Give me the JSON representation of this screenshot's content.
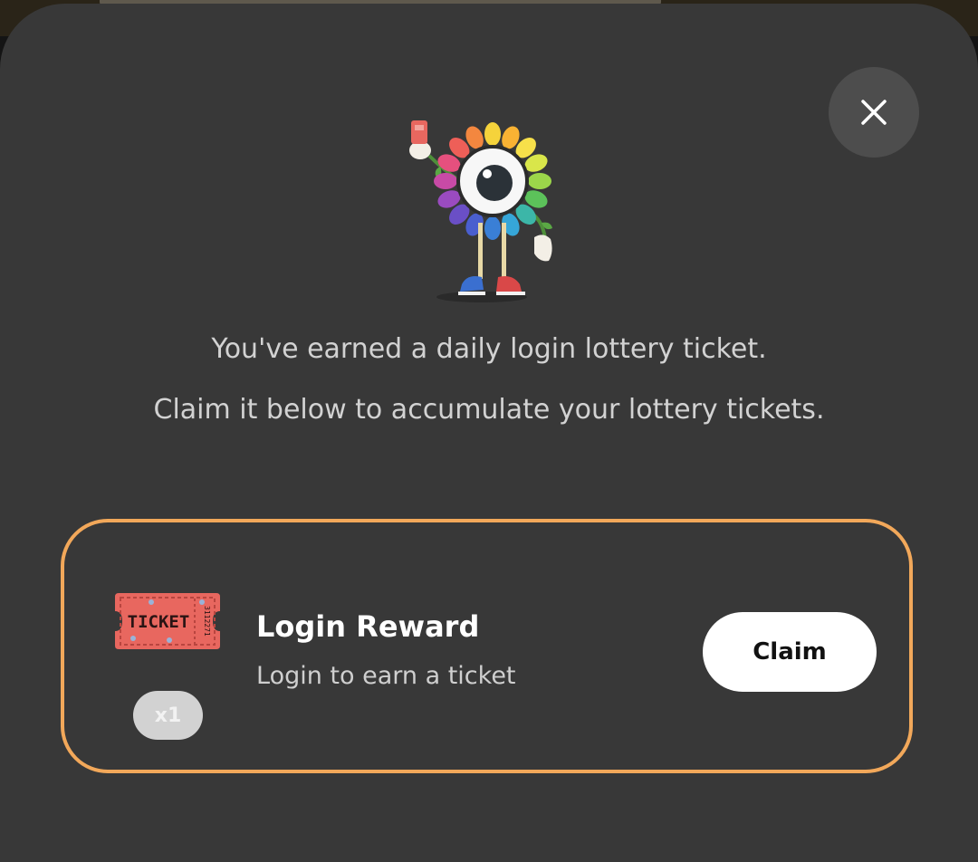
{
  "dialog": {
    "close_icon": "close-icon",
    "mascot_icon": "flower-eye-mascot-icon",
    "message_line1": "You've earned a daily login lottery ticket.",
    "message_line2": "Claim it below to accumulate your lottery tickets."
  },
  "reward": {
    "icon": "ticket-icon",
    "ticket_text": "TICKET",
    "ticket_serial": "3112271",
    "quantity": "x1",
    "title": "Login Reward",
    "description": "Login to earn a ticket",
    "claim_label": "Claim"
  },
  "colors": {
    "sheet_background": "#383838",
    "card_border": "#f2a85a",
    "claim_button": "#ffffff",
    "ticket": "#e8675f"
  }
}
